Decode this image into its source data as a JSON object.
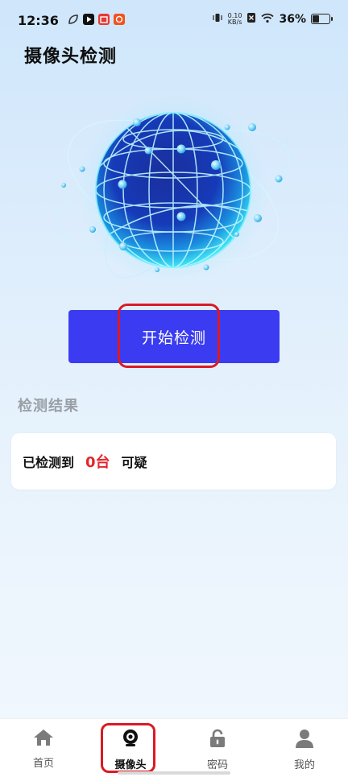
{
  "status_bar": {
    "time": "12:36",
    "net_speed_value": "0.10",
    "net_speed_unit": "KB/s",
    "battery": "36%",
    "app_icons": [
      "leaf-app-icon",
      "play-app-icon",
      "shop-app-icon",
      "news-app-icon"
    ]
  },
  "page": {
    "title": "摄像头检测"
  },
  "detect": {
    "start_button_label": "开始检测"
  },
  "results": {
    "section_title": "检测结果",
    "prefix": "已检测到",
    "count": "0台",
    "suffix": "可疑"
  },
  "nav": {
    "items": [
      {
        "label": "首页",
        "icon": "home-icon",
        "active": false
      },
      {
        "label": "摄像头",
        "icon": "camera-icon",
        "active": true
      },
      {
        "label": "密码",
        "icon": "lock-icon",
        "active": false
      },
      {
        "label": "我的",
        "icon": "user-icon",
        "active": false
      }
    ]
  },
  "colors": {
    "accent": "#3B3CF1",
    "highlight": "#D81B25",
    "count": "#E3262A"
  }
}
